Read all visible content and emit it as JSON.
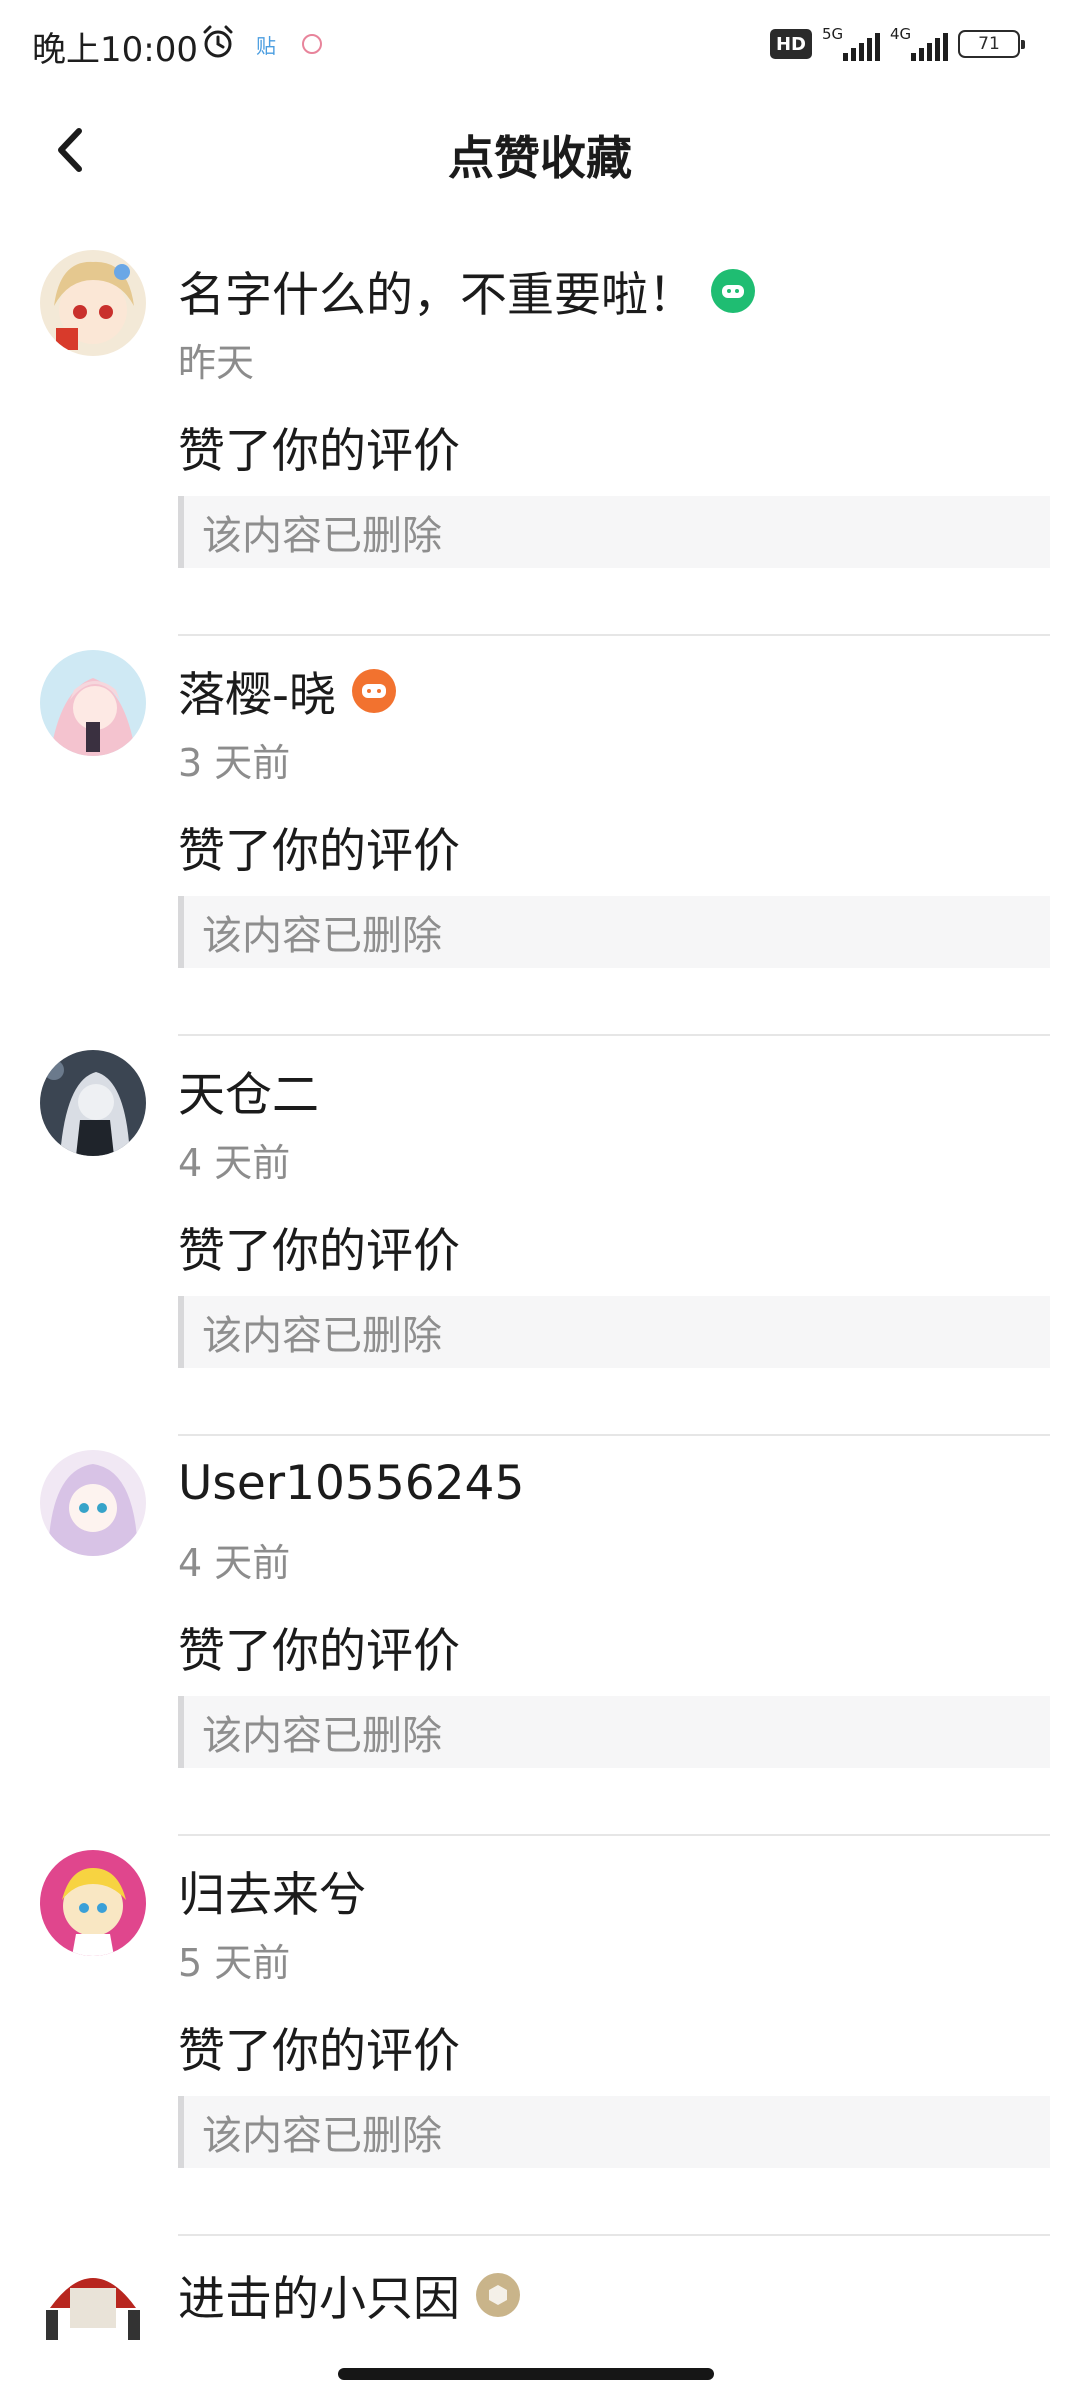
{
  "status_bar": {
    "time": "晚上10:00",
    "tie_label": "贴",
    "hd": "HD",
    "net1": "5G",
    "net2": "4G",
    "battery": "71"
  },
  "header": {
    "title": "点赞收藏"
  },
  "notifications": [
    {
      "name": "名字什么的，不重要啦！",
      "time": "昨天",
      "action": "赞了你的评价",
      "quote": "该内容已删除",
      "badge_color": "#1fbd72"
    },
    {
      "name": "落樱-晓",
      "time": "3 天前",
      "action": "赞了你的评价",
      "quote": "该内容已删除",
      "badge_color": "#f2722f"
    },
    {
      "name": "天仓二",
      "time": "4 天前",
      "action": "赞了你的评价",
      "quote": "该内容已删除"
    },
    {
      "name": "User10556245",
      "time": "4 天前",
      "action": "赞了你的评价",
      "quote": "该内容已删除"
    },
    {
      "name": "归去来兮",
      "time": "5 天前",
      "action": "赞了你的评价",
      "quote": "该内容已删除"
    },
    {
      "name": "进击的小只因",
      "badge_color": "#c9b48a"
    }
  ]
}
